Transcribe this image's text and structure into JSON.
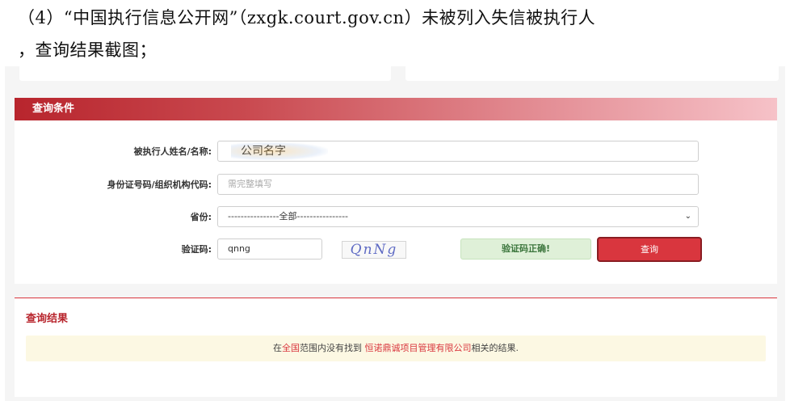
{
  "document": {
    "line1": "（4）“中国执行信息公开网”（zxgk.court.gov.cn）未被列入失信被执行人",
    "line2": "，查询结果截图；"
  },
  "query_panel": {
    "title": "查询条件",
    "name_label": "被执行人姓名/名称:",
    "name_value": "公司名字",
    "id_label": "身份证号码/组织机构代码:",
    "id_placeholder": "需完整填写",
    "province_label": "省份:",
    "province_value": "----------------全部----------------",
    "captcha_label": "验证码:",
    "captcha_value": "qnng",
    "captcha_image_text": "QnNg",
    "captcha_status": "验证码正确!",
    "query_button": "查询"
  },
  "result_panel": {
    "title": "查询结果",
    "message_prefix": "在",
    "message_scope": "全国",
    "message_mid": "范围内没有找到 ",
    "message_company": "恒诺鼎诚项目管理有限公司",
    "message_suffix": "相关的结果."
  },
  "colors": {
    "header_red": "#b8252d",
    "button_red": "#d9363e",
    "success_bg": "#dff0d8",
    "result_bg": "#fcf8e3"
  }
}
